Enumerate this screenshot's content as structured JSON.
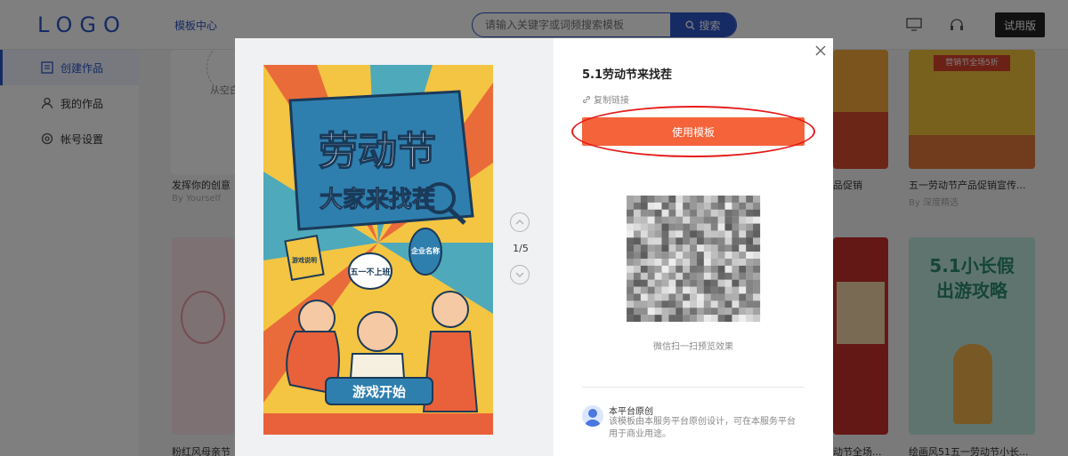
{
  "header": {
    "logo": "LOGO",
    "nav_center": "模板中心",
    "search_placeholder": "请输入关键字或词频搜索模板",
    "search_button": "搜索",
    "trial_button": "试用版"
  },
  "sidebar": {
    "items": [
      {
        "label": "创建作品",
        "icon": "create-icon",
        "active": true
      },
      {
        "label": "我的作品",
        "icon": "user-icon",
        "active": false
      },
      {
        "label": "帐号设置",
        "icon": "settings-icon",
        "active": false
      }
    ]
  },
  "background_cards": {
    "blank_label": "从空白",
    "card1_title": "发挥你的创意",
    "card1_author": "By Yourself",
    "card2_title": "品促销",
    "card3_title": "五一劳动节产品促销宣传...",
    "card3_author": "By 深度精选",
    "card4_title": "粉红风母亲节",
    "card5_title": "动节全场...",
    "card6_title": "绘画风51五一劳动节小长..."
  },
  "modal": {
    "title": "5.1劳动节来找茬",
    "copy_link": "复制链接",
    "use_template_button": "使用模板",
    "pager": {
      "current": "1",
      "total": "5",
      "text": "1/5"
    },
    "qr_caption": "微信扫一扫预览效果",
    "original_title": "本平台原创",
    "original_desc": "该模板由本服务平台原创设计，可在本服务平台用于商业用途。",
    "poster": {
      "headline": "劳动节",
      "subline": "大家来找茬",
      "bubble_left": "五一不上班",
      "bubble_right": "企业名称",
      "sign": "游戏说明",
      "banner": "游戏开始"
    }
  },
  "colors": {
    "brand": "#2d55c8",
    "accent": "#f5633a",
    "highlight": "#e51b1b"
  }
}
